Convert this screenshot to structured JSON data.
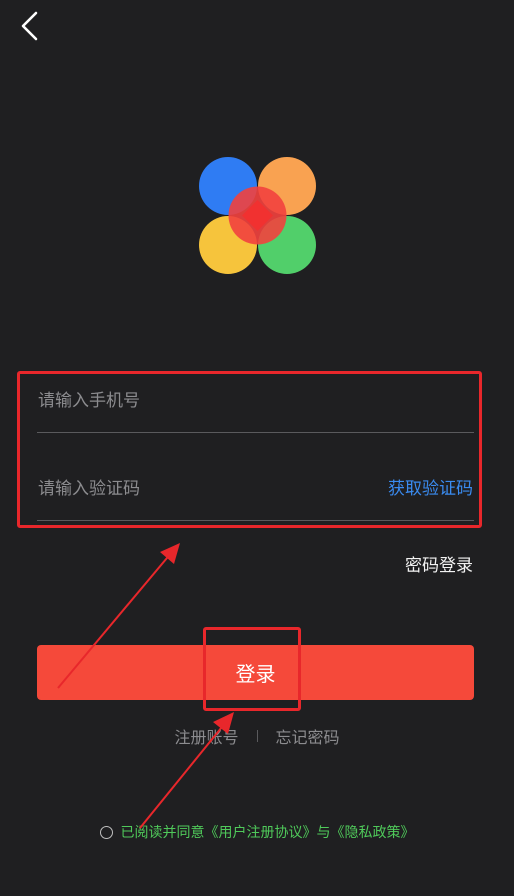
{
  "header": {
    "back_icon": "chevron-left-icon"
  },
  "logo": {
    "icon": "four-circle-logo-icon",
    "colors": [
      "#2f7cf3",
      "#f9a251",
      "#f6c43c",
      "#51cf6a",
      "#f2413e"
    ]
  },
  "form": {
    "phone_placeholder": "请输入手机号",
    "code_placeholder": "请输入验证码",
    "get_code_label": "获取验证码"
  },
  "password_login_label": "密码登录",
  "login_button_label": "登录",
  "links": {
    "register": "注册账号",
    "forgot": "忘记密码"
  },
  "agreement": {
    "prefix": "已阅读并同意",
    "user_agreement": "《用户注册协议》",
    "conjunction": "与",
    "privacy_policy": "《隐私政策》"
  },
  "colors": {
    "background": "#1f1f21",
    "accent_button": "#f5493a",
    "link_blue": "#3a8bf0",
    "agreement_green": "#4fc95a",
    "annotation_red": "#e8272b"
  }
}
